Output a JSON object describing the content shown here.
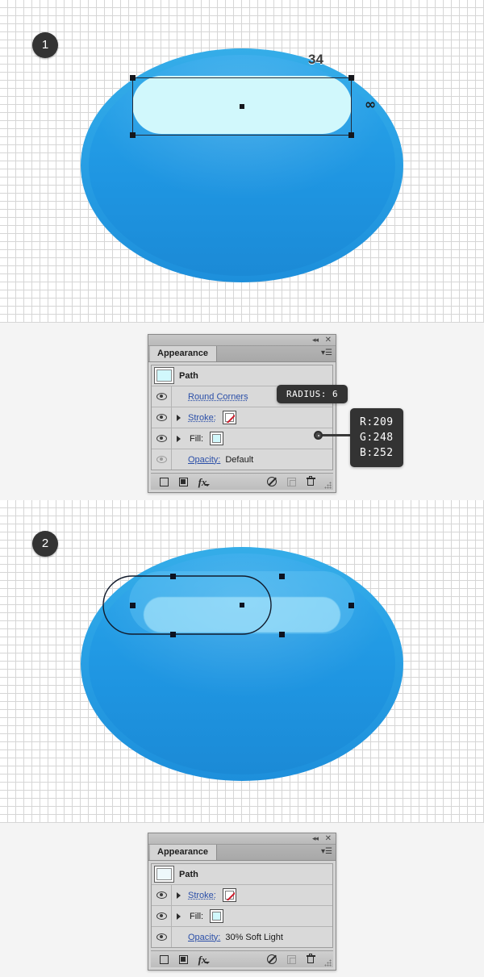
{
  "steps": [
    {
      "badge": "1",
      "dimension_label": "34",
      "cursor_icon": "infinity-cursor-icon"
    },
    {
      "badge": "2"
    }
  ],
  "panel1": {
    "titlebar": {
      "collapse_icon": "◂◂",
      "close_icon": "✕"
    },
    "tab": {
      "label": "Appearance",
      "menu_icon": "▾☰"
    },
    "rows": [
      {
        "type": "header",
        "name": "Path",
        "swatch_color": "#d1f8fc"
      },
      {
        "type": "effect",
        "label": "Round Corners",
        "visible": true
      },
      {
        "type": "stroke",
        "label": "Stroke:",
        "swatch": "none",
        "visible": true
      },
      {
        "type": "fill",
        "label": "Fill:",
        "swatch_color": "#d1f8fc",
        "visible": true
      },
      {
        "type": "opacity",
        "label": "Opacity:",
        "value": "Default",
        "visible": false
      }
    ],
    "footer": {
      "add_stroke_icon": "add-new-stroke-icon",
      "add_fill_icon": "add-new-fill-icon",
      "fx_label": "fx",
      "clear_icon": "clear-appearance-icon",
      "duplicate_icon": "duplicate-item-icon",
      "delete_icon": "delete-item-icon"
    }
  },
  "panel2": {
    "titlebar": {
      "collapse_icon": "◂◂",
      "close_icon": "✕"
    },
    "tab": {
      "label": "Appearance",
      "menu_icon": "▾☰"
    },
    "rows": [
      {
        "type": "header",
        "name": "Path",
        "swatch_color": "#eef8fb"
      },
      {
        "type": "stroke",
        "label": "Stroke:",
        "swatch": "none",
        "visible": true
      },
      {
        "type": "fill",
        "label": "Fill:",
        "swatch_color": "#d1f8fc",
        "visible": true
      },
      {
        "type": "opacity",
        "label": "Opacity:",
        "value": "30% Soft Light",
        "visible": true
      }
    ],
    "footer": {
      "add_stroke_icon": "add-new-stroke-icon",
      "add_fill_icon": "add-new-fill-icon",
      "fx_label": "fx",
      "clear_icon": "clear-appearance-icon",
      "duplicate_icon": "duplicate-item-icon",
      "delete_icon": "delete-item-icon"
    }
  },
  "tooltips": {
    "radius": "RADIUS: 6",
    "rgb": "R:209\nG:248\nB:252"
  },
  "colors": {
    "highlight_fill": "#d1f8fc",
    "ellipse_outer": "#2ba3e6",
    "ellipse_inner": "#1f96e2",
    "tooltip_bg": "#333333",
    "badge_bg": "#333333",
    "link": "#2b4fa8"
  }
}
